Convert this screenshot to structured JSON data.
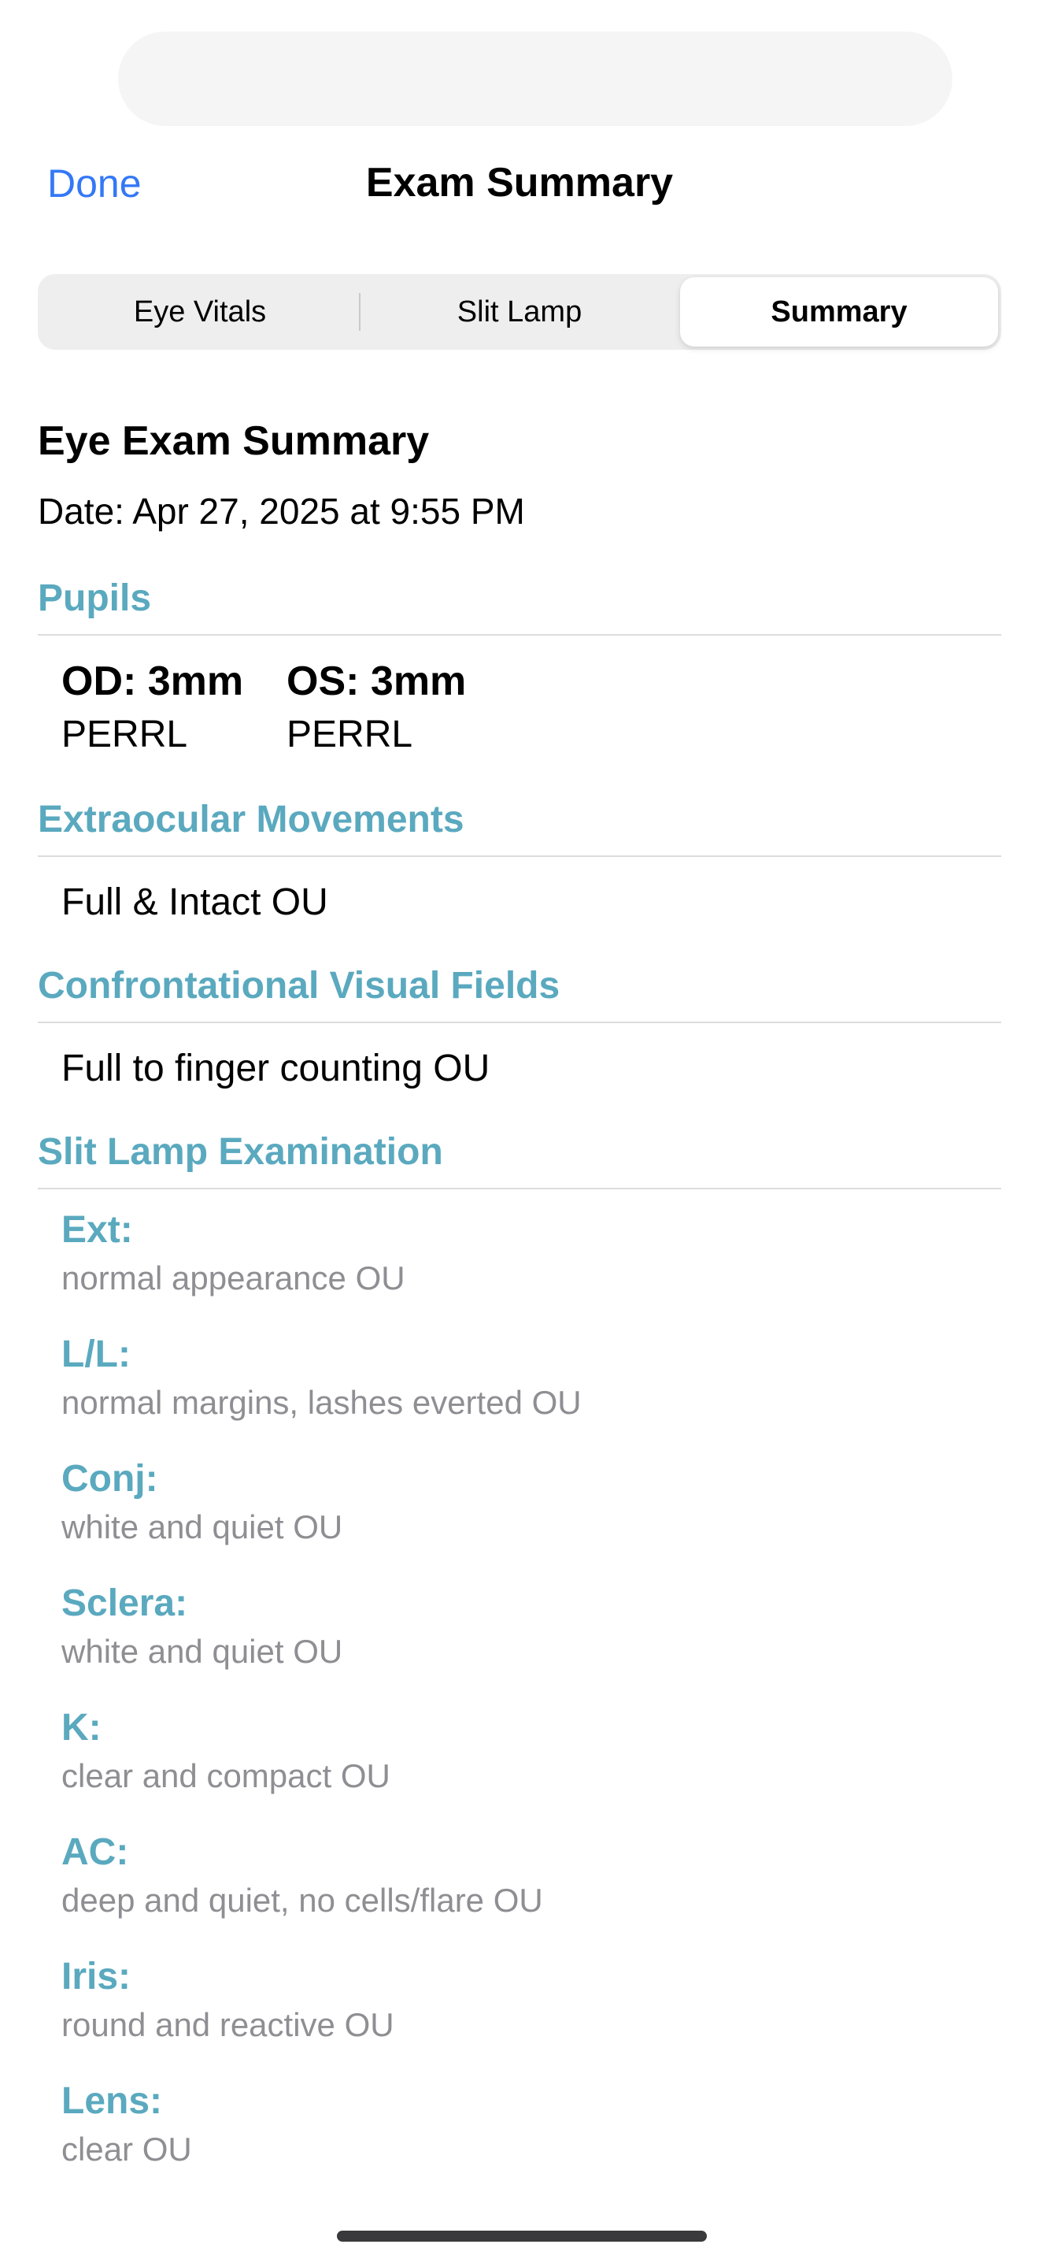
{
  "nav": {
    "done_label": "Done",
    "title": "Exam Summary"
  },
  "tabs": [
    {
      "label": "Eye Vitals",
      "selected": false
    },
    {
      "label": "Slit Lamp",
      "selected": false
    },
    {
      "label": "Summary",
      "selected": true
    }
  ],
  "summary": {
    "title": "Eye Exam Summary",
    "date": "Date: Apr 27, 2025 at 9:55 PM"
  },
  "pupils": {
    "header": "Pupils",
    "od": {
      "size": "OD: 3mm",
      "note": "PERRL"
    },
    "os": {
      "size": "OS: 3mm",
      "note": "PERRL"
    }
  },
  "extraocular": {
    "header": "Extraocular Movements",
    "value": "Full & Intact OU"
  },
  "visual_fields": {
    "header": "Confrontational Visual Fields",
    "value": "Full to finger counting OU"
  },
  "slit_lamp": {
    "header": "Slit Lamp Examination",
    "items": [
      {
        "label": "Ext:",
        "value": "normal appearance OU"
      },
      {
        "label": "L/L:",
        "value": "normal margins, lashes everted OU"
      },
      {
        "label": "Conj:",
        "value": "white and quiet OU"
      },
      {
        "label": "Sclera:",
        "value": "white and quiet OU"
      },
      {
        "label": "K:",
        "value": "clear and compact OU"
      },
      {
        "label": "AC:",
        "value": "deep and quiet, no cells/flare OU"
      },
      {
        "label": "Iris:",
        "value": "round and reactive OU"
      },
      {
        "label": "Lens:",
        "value": "clear OU"
      }
    ]
  },
  "colors": {
    "accent_blue": "#3478f6",
    "section_teal": "#5aa9bf",
    "secondary_gray": "#8e8e93"
  }
}
